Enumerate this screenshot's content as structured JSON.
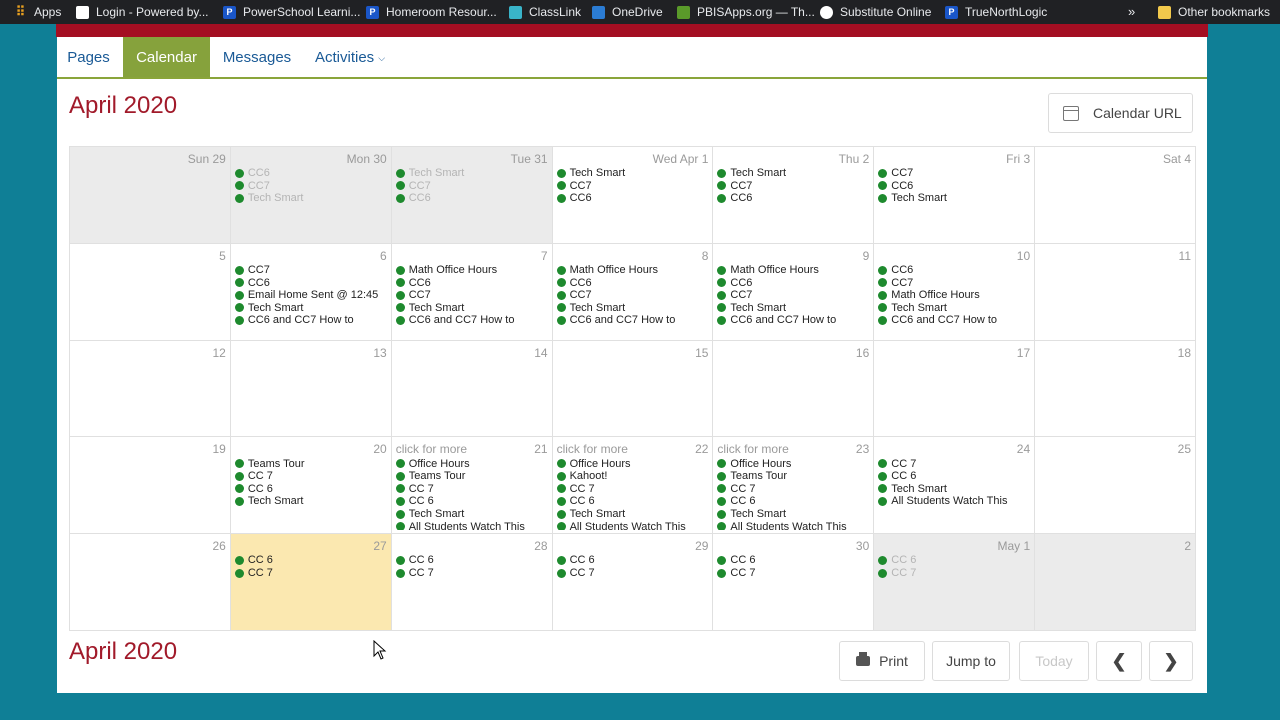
{
  "bookmarks": [
    {
      "label": "Apps",
      "icon": "apps-grid-icon",
      "color": "#e8eaed"
    },
    {
      "label": "Login - Powered by...",
      "icon": "login-favicon-icon",
      "color": "#ffffff"
    },
    {
      "label": "PowerSchool Learni...",
      "icon": "powerschool-p-icon",
      "color": "#1a56c8"
    },
    {
      "label": "Homeroom Resour...",
      "icon": "powerschool-p-icon",
      "color": "#1a56c8"
    },
    {
      "label": "ClassLink",
      "icon": "classlink-cloud-icon",
      "color": "#39b4c9"
    },
    {
      "label": "OneDrive",
      "icon": "onedrive-cloud-icon",
      "color": "#2b7cd3"
    },
    {
      "label": "PBISApps.org — Th...",
      "icon": "pbis-icon",
      "color": "#5a9a2a"
    },
    {
      "label": "Substitute Online",
      "icon": "globe-icon",
      "color": "#e8eaed"
    },
    {
      "label": "TrueNorthLogic",
      "icon": "powerschool-p-icon",
      "color": "#1a56c8"
    }
  ],
  "other_bookmarks": "Other bookmarks",
  "overflow": "»",
  "tabs": [
    {
      "label": "Pages",
      "active": false
    },
    {
      "label": "Calendar",
      "active": true
    },
    {
      "label": "Messages",
      "active": false
    },
    {
      "label": "Activities",
      "active": false,
      "dropdown": true
    }
  ],
  "title_top": "April 2020",
  "title_bottom": "April 2020",
  "calendar_url_label": "Calendar URL",
  "calendar": [
    [
      {
        "day": "Sun 29",
        "state": "gray",
        "events": []
      },
      {
        "day": "Mon 30",
        "state": "gray",
        "events": [
          {
            "t": "CC6",
            "dim": true
          },
          {
            "t": "CC7",
            "dim": true
          },
          {
            "t": "Tech Smart",
            "dim": true
          }
        ]
      },
      {
        "day": "Tue 31",
        "state": "gray",
        "events": [
          {
            "t": "Tech Smart",
            "dim": true
          },
          {
            "t": "CC7",
            "dim": true
          },
          {
            "t": "CC6",
            "dim": true
          }
        ]
      },
      {
        "day": "Wed Apr 1",
        "events": [
          {
            "t": "Tech Smart"
          },
          {
            "t": "CC7"
          },
          {
            "t": "CC6"
          }
        ]
      },
      {
        "day": "Thu 2",
        "events": [
          {
            "t": "Tech Smart"
          },
          {
            "t": "CC7"
          },
          {
            "t": "CC6"
          }
        ]
      },
      {
        "day": "Fri 3",
        "events": [
          {
            "t": "CC7"
          },
          {
            "t": "CC6"
          },
          {
            "t": "Tech Smart"
          }
        ]
      },
      {
        "day": "Sat 4",
        "events": []
      }
    ],
    [
      {
        "day": "5",
        "events": []
      },
      {
        "day": "6",
        "events": [
          {
            "t": "CC7"
          },
          {
            "t": "CC6"
          },
          {
            "t": "Email Home Sent @ 12:45"
          },
          {
            "t": "Tech Smart"
          },
          {
            "t": "CC6 and CC7 How to"
          }
        ]
      },
      {
        "day": "7",
        "events": [
          {
            "t": "Math Office Hours"
          },
          {
            "t": "CC6"
          },
          {
            "t": "CC7"
          },
          {
            "t": "Tech Smart"
          },
          {
            "t": "CC6 and CC7 How to"
          }
        ]
      },
      {
        "day": "8",
        "events": [
          {
            "t": "Math Office Hours"
          },
          {
            "t": "CC6"
          },
          {
            "t": "CC7"
          },
          {
            "t": "Tech Smart"
          },
          {
            "t": "CC6 and CC7 How to"
          }
        ]
      },
      {
        "day": "9",
        "events": [
          {
            "t": "Math Office Hours"
          },
          {
            "t": "CC6"
          },
          {
            "t": "CC7"
          },
          {
            "t": "Tech Smart"
          },
          {
            "t": "CC6 and CC7 How to"
          }
        ]
      },
      {
        "day": "10",
        "events": [
          {
            "t": "CC6"
          },
          {
            "t": "CC7"
          },
          {
            "t": "Math Office Hours"
          },
          {
            "t": "Tech Smart"
          },
          {
            "t": "CC6 and CC7 How to"
          }
        ]
      },
      {
        "day": "11",
        "events": []
      }
    ],
    [
      {
        "day": "12",
        "events": []
      },
      {
        "day": "13",
        "events": []
      },
      {
        "day": "14",
        "events": []
      },
      {
        "day": "15",
        "events": []
      },
      {
        "day": "16",
        "events": []
      },
      {
        "day": "17",
        "events": []
      },
      {
        "day": "18",
        "events": []
      }
    ],
    [
      {
        "day": "19",
        "events": []
      },
      {
        "day": "20",
        "events": [
          {
            "t": "Teams Tour"
          },
          {
            "t": "CC 7"
          },
          {
            "t": "CC 6"
          },
          {
            "t": "Tech Smart"
          }
        ]
      },
      {
        "day": "21",
        "more": "click for more",
        "events": [
          {
            "t": "Office Hours"
          },
          {
            "t": "Teams Tour"
          },
          {
            "t": "CC 7"
          },
          {
            "t": "CC 6"
          },
          {
            "t": "Tech Smart"
          },
          {
            "t": "All Students Watch This"
          }
        ]
      },
      {
        "day": "22",
        "more": "click for more",
        "events": [
          {
            "t": "Office Hours"
          },
          {
            "t": "Kahoot!"
          },
          {
            "t": "CC 7"
          },
          {
            "t": "CC 6"
          },
          {
            "t": "Tech Smart"
          },
          {
            "t": "All Students Watch This"
          }
        ]
      },
      {
        "day": "23",
        "more": "click for more",
        "events": [
          {
            "t": "Office Hours"
          },
          {
            "t": "Teams Tour"
          },
          {
            "t": "CC 7"
          },
          {
            "t": "CC 6"
          },
          {
            "t": "Tech Smart"
          },
          {
            "t": "All Students Watch This"
          }
        ]
      },
      {
        "day": "24",
        "events": [
          {
            "t": "CC 7"
          },
          {
            "t": "CC 6"
          },
          {
            "t": "Tech Smart"
          },
          {
            "t": "All Students Watch This"
          }
        ]
      },
      {
        "day": "25",
        "events": []
      }
    ],
    [
      {
        "day": "26",
        "events": []
      },
      {
        "day": "27",
        "state": "today",
        "events": [
          {
            "t": "CC 6"
          },
          {
            "t": "CC 7"
          }
        ]
      },
      {
        "day": "28",
        "events": [
          {
            "t": "CC 6"
          },
          {
            "t": "CC 7"
          }
        ]
      },
      {
        "day": "29",
        "events": [
          {
            "t": "CC 6"
          },
          {
            "t": "CC 7"
          }
        ]
      },
      {
        "day": "30",
        "events": [
          {
            "t": "CC 6"
          },
          {
            "t": "CC 7"
          }
        ]
      },
      {
        "day": "May 1",
        "state": "gray",
        "events": [
          {
            "t": "CC 6",
            "dim": true
          },
          {
            "t": "CC 7",
            "dim": true
          }
        ]
      },
      {
        "day": "2",
        "state": "gray",
        "events": []
      }
    ]
  ],
  "toolbar": {
    "print": "Print",
    "jump": "Jump to",
    "today": "Today",
    "prev": "‹",
    "next": "›"
  },
  "colors": {
    "brand_red": "#a11a2a",
    "tab_green": "#86a23c",
    "event_dot": "#1e8a2e",
    "today_bg": "#fbe8b0",
    "page_bg": "#0f7f96"
  }
}
